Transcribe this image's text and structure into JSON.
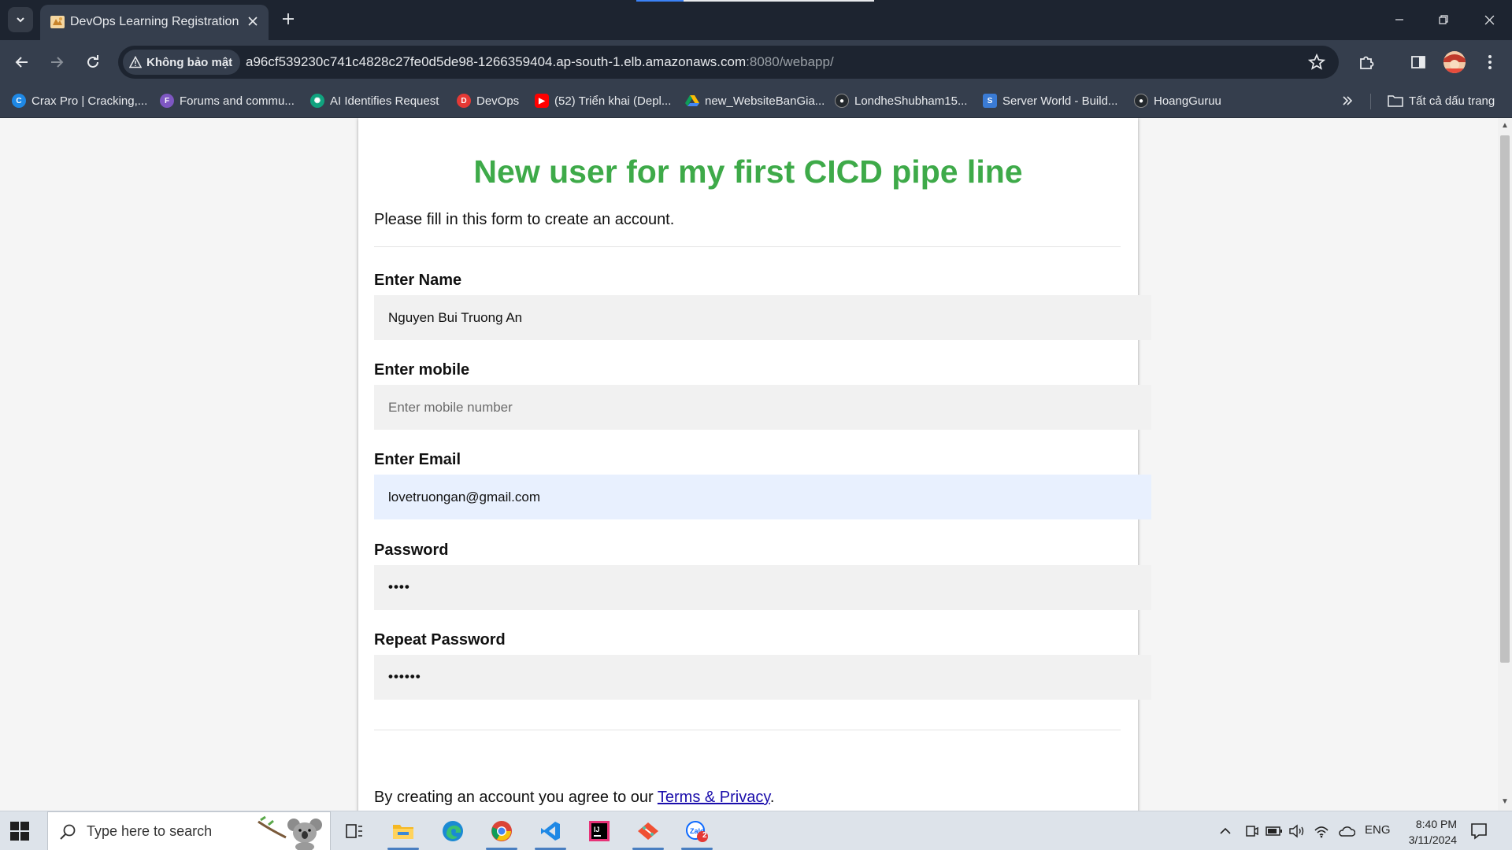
{
  "browser": {
    "tab": {
      "title": "DevOps Learning Registration"
    },
    "address": {
      "security_label": "Không bảo mật",
      "url_host": "a96cf539230c741c4828c27fe0d5de98-1266359404.ap-south-1.elb.amazonaws.com",
      "url_rest": ":8080/webapp/"
    },
    "bookmarks": [
      {
        "label": "Crax Pro | Cracking,...",
        "icon": "crax-icon",
        "color": "#1e88e5"
      },
      {
        "label": "Forums and commu...",
        "icon": "forum-icon",
        "color": "#7e57c2"
      },
      {
        "label": "AI Identifies Request",
        "icon": "openai-icon",
        "color": "#10a37f"
      },
      {
        "label": "DevOps",
        "icon": "devops-icon",
        "color": "#e53935"
      },
      {
        "label": "(52) Triển khai (Depl...",
        "icon": "youtube-icon",
        "color": "#ff0000"
      },
      {
        "label": "new_WebsiteBanGia...",
        "icon": "google-drive-icon",
        "color": "#fbbc04"
      },
      {
        "label": "LondheShubham15...",
        "icon": "github-icon",
        "color": "#24292e"
      },
      {
        "label": "Server World - Build...",
        "icon": "server-world-icon",
        "color": "#3a7bd5"
      },
      {
        "label": "HoangGuruu",
        "icon": "github-icon",
        "color": "#24292e"
      }
    ],
    "all_bookmarks_label": "Tất cả dấu trang"
  },
  "page": {
    "title": "New user for my first CICD pipe line",
    "intro": "Please fill in this form to create an account.",
    "fields": {
      "name": {
        "label": "Enter Name",
        "value": "Nguyen Bui Truong An",
        "placeholder": ""
      },
      "mobile": {
        "label": "Enter mobile",
        "value": "",
        "placeholder": "Enter mobile number"
      },
      "email": {
        "label": "Enter Email",
        "value": "lovetruongan@gmail.com",
        "placeholder": ""
      },
      "password": {
        "label": "Password",
        "masked": "••••"
      },
      "repeat_password": {
        "label": "Repeat Password",
        "masked": "••••••"
      }
    },
    "agree": {
      "prefix": "By creating an account you agree to our ",
      "link": "Terms & Privacy",
      "suffix": "."
    }
  },
  "taskbar": {
    "search_placeholder": "Type here to search",
    "apps": [
      "task-view-icon",
      "file-explorer-icon",
      "edge-icon",
      "chrome-icon",
      "vscode-icon",
      "intellij-icon",
      "git-icon",
      "zalo-icon"
    ],
    "zalo_badge": "2",
    "language": "ENG",
    "time": "8:40 PM",
    "date": "3/11/2024"
  },
  "colors": {
    "title_green": "#3eaa49",
    "link_blue": "#1a0dab",
    "autofill_blue": "#e8f0fe",
    "chrome_dark": "#1d2430"
  }
}
